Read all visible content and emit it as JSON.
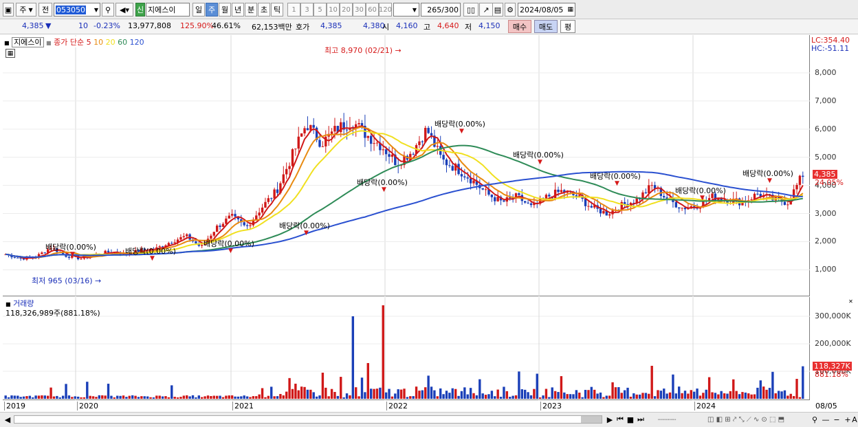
{
  "toolbar": {
    "period": "주",
    "prev": "전",
    "code": "053050",
    "new_badge": "신",
    "name": "지에스이",
    "tabs": [
      "일",
      "주",
      "월",
      "년",
      "분",
      "초",
      "틱"
    ],
    "active_tab": "주",
    "intervals": [
      "1",
      "3",
      "5",
      "10",
      "20",
      "30",
      "60",
      "120"
    ],
    "count": "265",
    "count_max": "/300",
    "date": "2024/08/05"
  },
  "quote": {
    "price": "4,385",
    "arrow": "▼",
    "change": "10",
    "change_pct": "-0.23%",
    "volume": "13,977,808",
    "vol_ratio": "125.90%",
    "turnover": "46.61%",
    "amount": "62,153백만",
    "bid_label": "호가",
    "ask": "4,385",
    "bid": "4,380",
    "open_label": "시",
    "open": "4,160",
    "high_label": "고",
    "high": "4,640",
    "low_label": "저",
    "low": "4,150",
    "buy_button": "매수",
    "sell_button": "매도",
    "eval_button": "평"
  },
  "legend": {
    "name": "지에스이",
    "title": "종가 단순",
    "ma_periods": [
      "5",
      "10",
      "20",
      "60",
      "120"
    ],
    "ma_colors": [
      "#d01818",
      "#e88a10",
      "#f0e020",
      "#2e8b57",
      "#2a50d0"
    ]
  },
  "right_info": {
    "lc": "LC:354.40",
    "hc": "HC:-51.11"
  },
  "annotations": {
    "high": "최고 8,970 (02/21)",
    "low": "최저 965 (03/16)",
    "dividends": [
      "배당락(0.00%)",
      "배당락(0.00%)",
      "배당락(0.00%)",
      "배당락(0.00%)",
      "배당락(0.00%)",
      "배당락(0.00%)",
      "배당락(0.00%)",
      "배당락(0.00%)",
      "배당락(0.00%)",
      "배당락(0.00%)"
    ]
  },
  "price_axis": {
    "ticks": [
      "8,000",
      "7,000",
      "6,000",
      "5,000",
      "4,000",
      "3,000",
      "2,000",
      "1,000"
    ],
    "current": "4,385",
    "current_pct": "24.05%"
  },
  "volume_panel": {
    "label": "거래량",
    "value": "118,326,989주(881.18%)",
    "ticks": [
      "300,000K",
      "200,000K",
      "100,000K"
    ],
    "current": "118,327K",
    "current_pct": "881.18%"
  },
  "x_axis": {
    "labels": [
      "2019",
      "2020",
      "2021",
      "2022",
      "2023",
      "2024"
    ],
    "right_label": "08/05"
  },
  "colors": {
    "up": "#d01818",
    "down": "#1a3fb8",
    "accent": "#5b8ed6",
    "price_tag": "#e83030"
  },
  "chart_data": {
    "type": "candlestick",
    "title": "종가 단순",
    "ylim": [
      250,
      9150
    ],
    "x": [
      "2019",
      "2020",
      "2021",
      "2022",
      "2023",
      "2024"
    ],
    "high": {
      "value": 8970,
      "date": "02/21"
    },
    "low": {
      "value": 965,
      "date": "03/16"
    },
    "close_path": [
      1550,
      1400,
      1450,
      1800,
      1500,
      1400,
      1550,
      1650,
      1550,
      1700,
      1750,
      2000,
      2200,
      1800,
      2500,
      2900,
      2500,
      3200,
      3800,
      5000,
      6200,
      5500,
      6000,
      6300,
      5800,
      5400,
      4800,
      5200,
      6000,
      4900,
      4600,
      4200,
      3700,
      3400,
      3600,
      3200,
      3600,
      3800,
      3600,
      3200,
      3000,
      3300,
      3500,
      4000,
      3500,
      3200,
      3300,
      3600,
      3500,
      3400,
      3700,
      3500,
      3400,
      4385
    ],
    "moving_averages": [
      {
        "name": "5",
        "color": "#d01818"
      },
      {
        "name": "10",
        "color": "#e88a10"
      },
      {
        "name": "20",
        "color": "#f0e020"
      },
      {
        "name": "60",
        "color": "#2e8b57"
      },
      {
        "name": "120",
        "color": "#2a50d0"
      }
    ],
    "volume_ylim": [
      0,
      340000
    ],
    "volume_spikes_k": [
      {
        "i": 21,
        "v": 95000
      },
      {
        "i": 23,
        "v": 300000
      },
      {
        "i": 25,
        "v": 340000
      },
      {
        "i": 24,
        "v": 130000
      },
      {
        "i": 43,
        "v": 120000
      },
      {
        "i": 51,
        "v": 98000
      },
      {
        "i": 53,
        "v": 118327
      }
    ]
  }
}
